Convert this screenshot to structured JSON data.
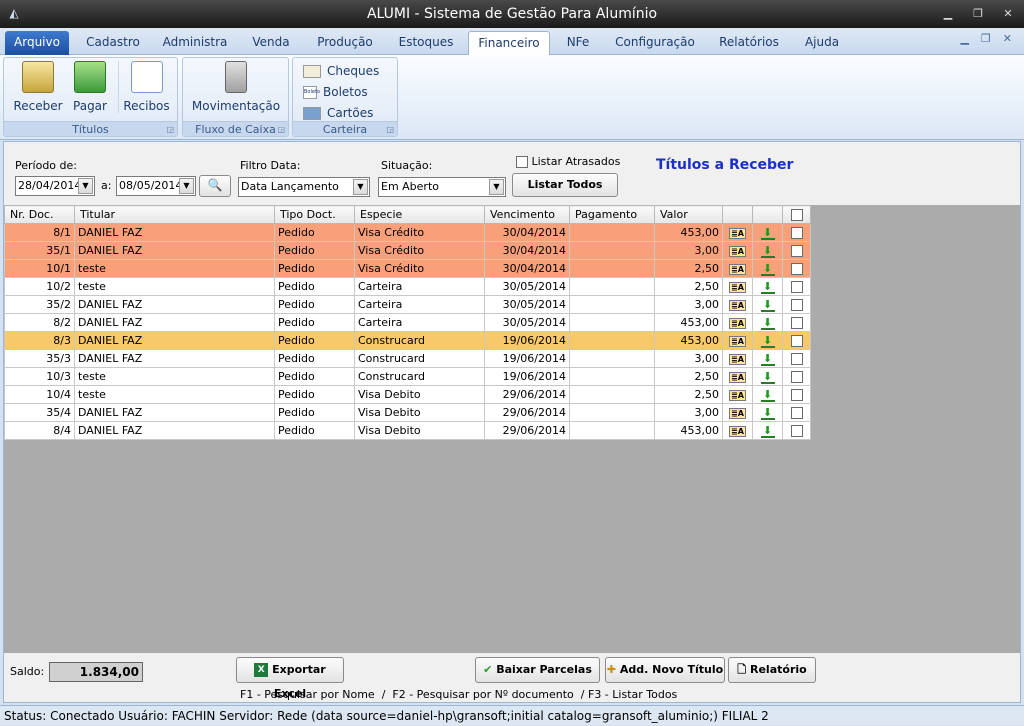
{
  "window": {
    "title": "ALUMI - Sistema de Gestão Para Alumínio",
    "icon": "app-logo-icon"
  },
  "menu": {
    "tabs": [
      {
        "label": "Arquivo"
      },
      {
        "label": "Cadastro"
      },
      {
        "label": "Administra"
      },
      {
        "label": "Venda"
      },
      {
        "label": "Produção"
      },
      {
        "label": "Estoques"
      },
      {
        "label": "Financeiro"
      },
      {
        "label": "NFe"
      },
      {
        "label": "Configuração"
      },
      {
        "label": "Relatórios"
      },
      {
        "label": "Ajuda"
      }
    ],
    "active": "Financeiro"
  },
  "ribbon": {
    "titulos": {
      "label": "Títulos",
      "receber": "Receber",
      "pagar": "Pagar",
      "recibos": "Recibos"
    },
    "fluxo": {
      "label": "Fluxo de Caixa",
      "movimentacao": "Movimentação"
    },
    "carteira": {
      "label": "Carteira",
      "cheques": "Cheques",
      "boletos": "Boletos",
      "cartoes": "Cartões",
      "boleto_icon_text": "Boleto"
    }
  },
  "filters": {
    "periodo_label": "Período de:",
    "date_from": "28/04/2014",
    "a_label": "a:",
    "date_to": "08/05/2014",
    "filtro_label": "Filtro Data:",
    "filtro_value": "Data Lançamento",
    "situacao_label": "Situação:",
    "situacao_value": "Em Aberto",
    "atrasados_label": "Listar Atrasados",
    "listar_todos": "Listar Todos",
    "section_title": "Títulos a Receber"
  },
  "grid": {
    "headers": [
      "Nr. Doc.",
      "Titular",
      "Tipo Doct.",
      "Especie",
      "Vencimento",
      "Pagamento",
      "Valor"
    ],
    "icon_text": "≣A",
    "rows": [
      {
        "doc": "8/1",
        "titular": "DANIEL FAZ",
        "tipo": "Pedido",
        "especie": "Visa Crédito",
        "venc": "30/04/2014",
        "pag": "",
        "valor": "453,00",
        "style": "red"
      },
      {
        "doc": "35/1",
        "titular": "DANIEL FAZ",
        "tipo": "Pedido",
        "especie": "Visa Crédito",
        "venc": "30/04/2014",
        "pag": "",
        "valor": "3,00",
        "style": "red"
      },
      {
        "doc": "10/1",
        "titular": "teste",
        "tipo": "Pedido",
        "especie": "Visa Crédito",
        "venc": "30/04/2014",
        "pag": "",
        "valor": "2,50",
        "style": "red"
      },
      {
        "doc": "10/2",
        "titular": "teste",
        "tipo": "Pedido",
        "especie": "Carteira",
        "venc": "30/05/2014",
        "pag": "",
        "valor": "2,50",
        "style": ""
      },
      {
        "doc": "35/2",
        "titular": "DANIEL FAZ",
        "tipo": "Pedido",
        "especie": "Carteira",
        "venc": "30/05/2014",
        "pag": "",
        "valor": "3,00",
        "style": ""
      },
      {
        "doc": "8/2",
        "titular": "DANIEL FAZ",
        "tipo": "Pedido",
        "especie": "Carteira",
        "venc": "30/05/2014",
        "pag": "",
        "valor": "453,00",
        "style": ""
      },
      {
        "doc": "8/3",
        "titular": "DANIEL FAZ",
        "tipo": "Pedido",
        "especie": "Construcard",
        "venc": "19/06/2014",
        "pag": "",
        "valor": "453,00",
        "style": "yel"
      },
      {
        "doc": "35/3",
        "titular": "DANIEL FAZ",
        "tipo": "Pedido",
        "especie": "Construcard",
        "venc": "19/06/2014",
        "pag": "",
        "valor": "3,00",
        "style": ""
      },
      {
        "doc": "10/3",
        "titular": "teste",
        "tipo": "Pedido",
        "especie": "Construcard",
        "venc": "19/06/2014",
        "pag": "",
        "valor": "2,50",
        "style": ""
      },
      {
        "doc": "10/4",
        "titular": "teste",
        "tipo": "Pedido",
        "especie": "Visa Debito",
        "venc": "29/06/2014",
        "pag": "",
        "valor": "2,50",
        "style": ""
      },
      {
        "doc": "35/4",
        "titular": "DANIEL FAZ",
        "tipo": "Pedido",
        "especie": "Visa Debito",
        "venc": "29/06/2014",
        "pag": "",
        "valor": "3,00",
        "style": ""
      },
      {
        "doc": "8/4",
        "titular": "DANIEL FAZ",
        "tipo": "Pedido",
        "especie": "Visa Debito",
        "venc": "29/06/2014",
        "pag": "",
        "valor": "453,00",
        "style": ""
      }
    ]
  },
  "footer": {
    "saldo_label": "Saldo:",
    "saldo_value": "1.834,00",
    "exportar": "Exportar Excel",
    "baixar": "Baixar Parcelas",
    "add": "Add. Novo Título",
    "relatorio": "Relatório",
    "shortcuts": "F1 - Pesquisar por Nome  /  F2 - Pesquisar por Nº documento  / F3 - Listar Todos"
  },
  "status": {
    "text": "Status: Conectado   Usuário: FACHIN  Servidor: Rede (data source=daniel-hp\\gransoft;initial catalog=gransoft_aluminio;)  FILIAL 2"
  }
}
